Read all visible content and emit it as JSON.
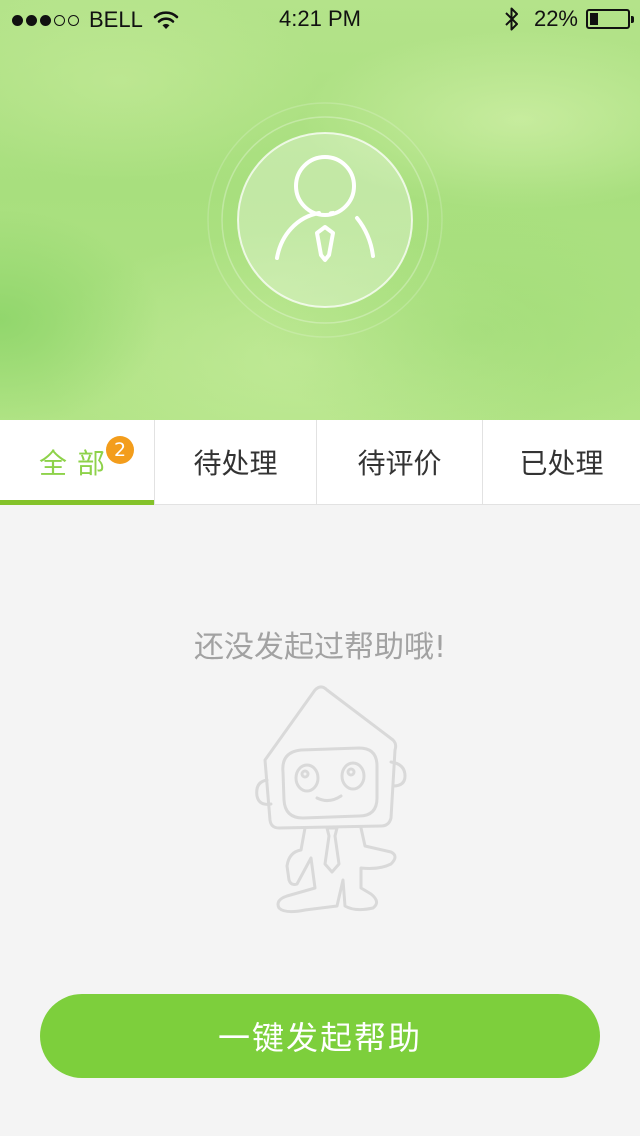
{
  "status_bar": {
    "carrier": "BELL",
    "time": "4:21 PM",
    "battery_percent": "22%",
    "battery_level": 0.22,
    "signal_bars_filled": 3,
    "signal_bars_total": 5
  },
  "header": {
    "avatar_icon": "user-avatar-icon"
  },
  "tabs": [
    {
      "label": "全部",
      "badge": "2",
      "active": true
    },
    {
      "label": "待处理"
    },
    {
      "label": "待评价"
    },
    {
      "label": "已处理"
    }
  ],
  "empty_state": {
    "message": "还没发起过帮助哦!",
    "illustration": "house-mascot-icon"
  },
  "cta": {
    "label": "一键发起帮助"
  },
  "colors": {
    "accent_green": "#7dcf3c",
    "active_tab_text": "#8ed24a",
    "badge_orange": "#f39d1c",
    "empty_text_gray": "#a2a2a2"
  }
}
